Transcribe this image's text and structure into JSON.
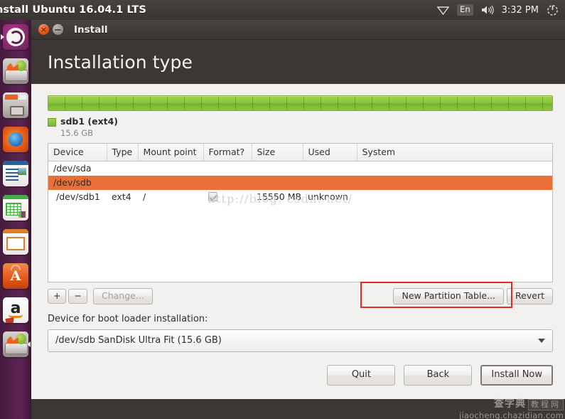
{
  "panel": {
    "title": "nstall Ubuntu 16.04.1 LTS",
    "keyboard_indicator": "En",
    "clock": "3:32 PM",
    "icons": [
      "network-icon",
      "keyboard-indicator",
      "volume-icon",
      "power-icon"
    ]
  },
  "launcher": {
    "items": [
      {
        "name": "ubuntu-dash"
      },
      {
        "name": "install-ubuntu"
      },
      {
        "name": "files"
      },
      {
        "name": "firefox"
      },
      {
        "name": "libreoffice-writer"
      },
      {
        "name": "libreoffice-calc"
      },
      {
        "name": "libreoffice-impress"
      },
      {
        "name": "ubuntu-software"
      },
      {
        "name": "amazon"
      },
      {
        "name": "install-ubuntu-bottom"
      }
    ]
  },
  "window": {
    "title": "Install",
    "close_label": "×",
    "minimize_label": "−",
    "page_title": "Installation type"
  },
  "partition_bar": {
    "legend_name": "sdb1 (ext4)",
    "legend_size": "15.6 GB",
    "color": "#8cc63f"
  },
  "table": {
    "columns": [
      "Device",
      "Type",
      "Mount point",
      "Format?",
      "Size",
      "Used",
      "System"
    ],
    "rows": [
      {
        "kind": "disk",
        "selected": false,
        "device": "/dev/sda",
        "type": "",
        "mount": "",
        "format": "",
        "size": "",
        "used": "",
        "system": ""
      },
      {
        "kind": "disk",
        "selected": true,
        "device": "/dev/sdb",
        "type": "",
        "mount": "",
        "format": "",
        "size": "",
        "used": "",
        "system": ""
      },
      {
        "kind": "partition",
        "selected": false,
        "device": "/dev/sdb1",
        "type": "ext4",
        "mount": "/",
        "format": "checked",
        "size": "15550 MB",
        "used": "unknown",
        "system": ""
      }
    ],
    "selected_row_color": "#e9703b"
  },
  "tools": {
    "add_label": "+",
    "remove_label": "−",
    "change_label": "Change...",
    "new_partition_table_label": "New Partition Table...",
    "revert_label": "Revert",
    "highlight_color": "#e02b1d"
  },
  "bootloader": {
    "label": "Device for boot loader installation:",
    "value": "/dev/sdb   SanDisk Ultra Fit (15.6 GB)"
  },
  "actions": {
    "quit_label": "Quit",
    "back_label": "Back",
    "install_label": "Install Now"
  },
  "watermarks": {
    "url": "http://blog. csdn. net/",
    "logo_cn": "查字典",
    "logo_cn2": "教程网",
    "logo_domain": "jiaocheng.chazidian.com"
  }
}
